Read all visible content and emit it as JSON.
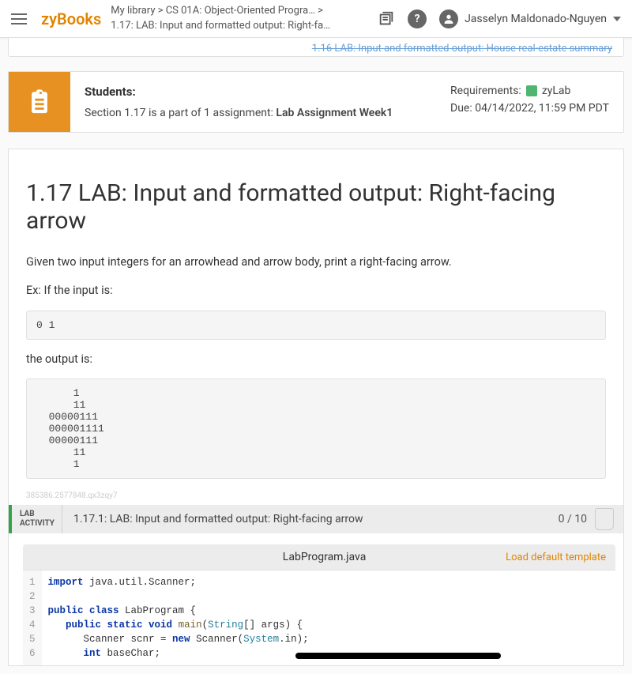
{
  "header": {
    "logo": "zyBooks",
    "breadcrumb_line1": "My library > CS 01A: Object-Oriented Progra…   >",
    "breadcrumb_line2": "1.17: LAB: Input and formatted output: Right-fa…",
    "username": "Jasselyn Maldonado-Nguyen"
  },
  "prev_link": "1.16 LAB: Input and formatted output: House real-estate summary",
  "students_card": {
    "heading": "Students:",
    "text_prefix": "Section 1.17 is a part of 1 assignment: ",
    "assignment": "Lab Assignment Week1",
    "requirements_label": "Requirements:",
    "requirements_value": "zyLab",
    "due": "Due: 04/14/2022, 11:59 PM PDT"
  },
  "lab": {
    "title": "1.17 LAB: Input and formatted output: Right-facing arrow",
    "desc": "Given two input integers for an arrowhead and arrow body, print a right-facing arrow.",
    "ex_label": "Ex: If the input is:",
    "input_sample": "0 1",
    "output_label": "the output is:",
    "output_sample": "      1\n      11\n  00000111\n  000001111\n  00000111\n      11\n      1"
  },
  "watermark": "385386.2577848.qx3zqy7",
  "activity": {
    "label_line1": "LAB",
    "label_line2": "ACTIVITY",
    "title": "1.17.1: LAB: Input and formatted output: Right-facing arrow",
    "score": "0 / 10"
  },
  "editor": {
    "filename": "LabProgram.java",
    "load_template": "Load default template",
    "lines": [
      {
        "n": "1",
        "html": "<span class='kw'>import</span> java.util.Scanner;"
      },
      {
        "n": "2",
        "html": ""
      },
      {
        "n": "3",
        "html": "<span class='kw'>public class</span> LabProgram {"
      },
      {
        "n": "4",
        "html": "   <span class='kw'>public static void</span> <span class='fn'>main</span>(<span class='cls'>String</span>[] args) {"
      },
      {
        "n": "5",
        "html": "      Scanner scnr = <span class='kw'>new</span> Scanner(<span class='cls'>System</span>.in);"
      },
      {
        "n": "6",
        "html": "      <span class='kw'>int</span> baseChar;"
      }
    ]
  }
}
